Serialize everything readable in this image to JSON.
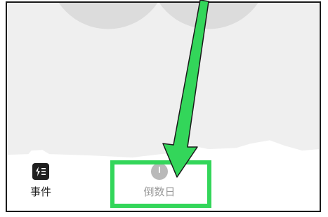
{
  "tabbar": {
    "tabs": [
      {
        "label": "事件",
        "icon": "events-icon",
        "selected": true
      },
      {
        "label": "倒数日",
        "icon": "countdown-clock-icon",
        "selected": false
      }
    ]
  },
  "annotation": {
    "color": "#33d65a",
    "arrow": "arrow-pointing-down",
    "highlight_target": "倒数日"
  },
  "colors": {
    "screen_bg": "#efefef",
    "decor_circle": "#dcdcdc",
    "text_primary": "#1f1f1f",
    "text_muted": "#9a9a9a"
  }
}
